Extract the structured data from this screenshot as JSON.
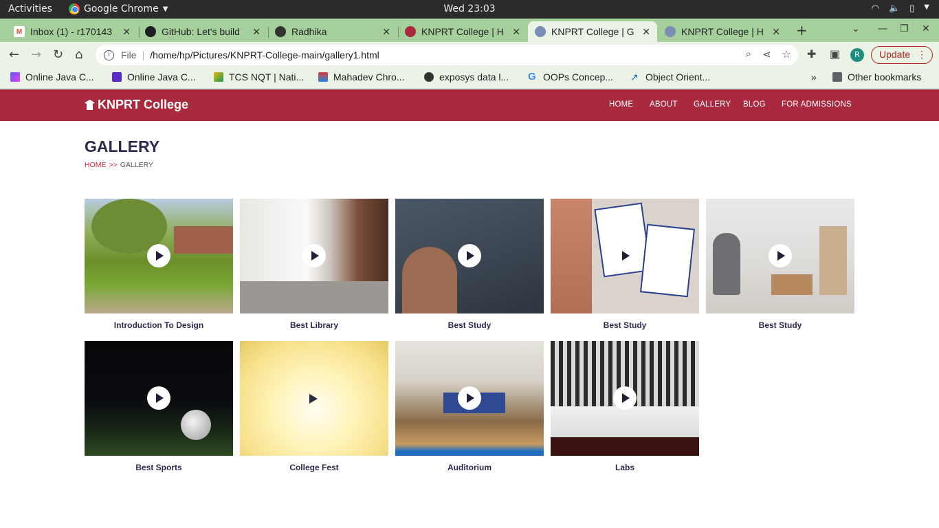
{
  "system": {
    "activities": "Activities",
    "app": "Google Chrome",
    "clock": "Wed 23:03"
  },
  "tabs": [
    {
      "title": "Inbox (1) - r170143",
      "icon": "gmail-icon"
    },
    {
      "title": "GitHub: Let's build",
      "icon": "github-icon"
    },
    {
      "title": "Radhika",
      "icon": "globe-icon"
    },
    {
      "title": "KNPRT College | H",
      "icon": "college-icon"
    },
    {
      "title": "KNPRT College | G",
      "icon": "college-icon"
    },
    {
      "title": "KNPRT College | H",
      "icon": "college-icon"
    }
  ],
  "address": {
    "scheme": "File",
    "url": "/home/hp/Pictures/KNPRT-College-main/gallery1.html"
  },
  "profile_initial": "R",
  "update_label": "Update",
  "bookmarks": [
    "Online Java C...",
    "Online Java C...",
    "TCS NQT | Nati...",
    "Mahadev Chro...",
    "exposys data l...",
    "OOPs Concep...",
    "Object Orient..."
  ],
  "bookmarks_more": "»",
  "other_bookmarks": "Other bookmarks",
  "site": {
    "brand": "KNPRT College",
    "nav": [
      "HOME",
      "ABOUT",
      "GALLERY",
      "BLOG",
      "FOR ADMISSIONS"
    ],
    "title": "GALLERY",
    "breadcrumb": {
      "home": "HOME",
      "sep": ">>",
      "current": "GALLERY"
    },
    "gallery": [
      {
        "caption": "Introduction To Design"
      },
      {
        "caption": "Best Library"
      },
      {
        "caption": "Best Study"
      },
      {
        "caption": "Best Study"
      },
      {
        "caption": "Best Study"
      },
      {
        "caption": "Best Sports"
      },
      {
        "caption": "College Fest"
      },
      {
        "caption": "Auditorium"
      },
      {
        "caption": "Labs"
      }
    ]
  },
  "colors": {
    "nav_bg": "#a92a3f",
    "title": "#2b2a4c",
    "accent": "#c8283e",
    "tab_strip": "#a6d09b"
  }
}
